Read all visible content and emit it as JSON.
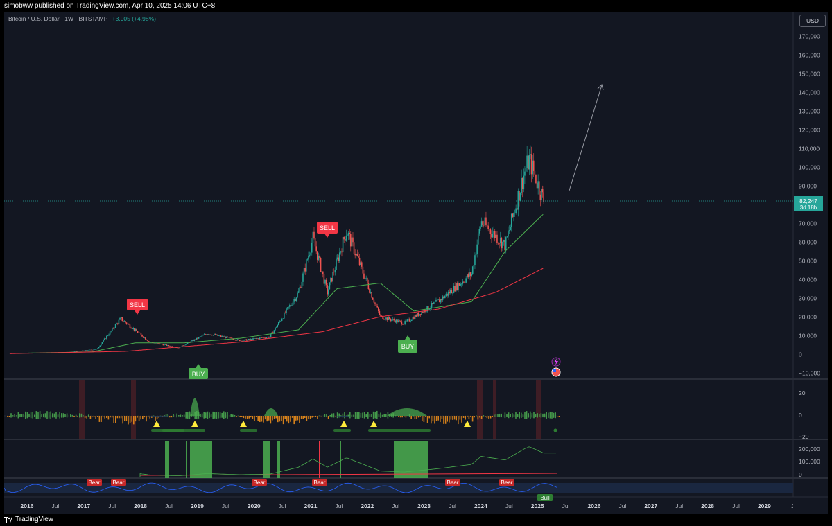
{
  "header": {
    "publisher_line": "simobww published on TradingView.com, Apr 10, 2025 14:06 UTC+8"
  },
  "legend": {
    "symbol_line": "Bitcoin / U.S. Dollar · 1W · BITSTAMP",
    "change": "+3,905 (+4.98%)"
  },
  "currency_button": "USD",
  "last_price": {
    "value": "82,247",
    "countdown": "3d 18h",
    "color": "#26a69a"
  },
  "price_axis": [
    "170,000",
    "160,000",
    "150,000",
    "140,000",
    "130,000",
    "120,000",
    "110,000",
    "100,000",
    "90,000",
    "80,000",
    "70,000",
    "60,000",
    "50,000",
    "40,000",
    "30,000",
    "20,000",
    "10,000",
    "0",
    "−10,000"
  ],
  "osc1_axis": [
    "20",
    "0",
    "−20"
  ],
  "osc2_axis": [
    "200,000",
    "100,000",
    "0"
  ],
  "time_axis": [
    "2016",
    "Jul",
    "2017",
    "Jul",
    "2018",
    "Jul",
    "2019",
    "Jul",
    "2020",
    "Jul",
    "2021",
    "Jul",
    "2022",
    "Jul",
    "2023",
    "Jul",
    "2024",
    "Jul",
    "2025",
    "Jul",
    "2026",
    "Jul",
    "2027",
    "Jul",
    "2028",
    "Jul",
    "2029",
    "J"
  ],
  "signals": [
    {
      "label": "SELL",
      "color": "#f23645"
    },
    {
      "label": "SELL",
      "color": "#f23645"
    },
    {
      "label": "BUY",
      "color": "#4caf50"
    },
    {
      "label": "BUY",
      "color": "#4caf50"
    }
  ],
  "rsi_tags": [
    "Bear",
    "Bear",
    "Bear",
    "Bear",
    "Bear",
    "Bear",
    "Bull"
  ],
  "colors": {
    "bull": "#26a69a",
    "bear": "#ef5350",
    "ma_green": "#4caf50",
    "ma_red": "#f23645",
    "accent": "#2962ff"
  },
  "footer": {
    "brand": "TradingView"
  },
  "chart_data": {
    "type": "line",
    "title": "Bitcoin / U.S. Dollar · 1W · BITSTAMP",
    "xlabel": "",
    "ylabel": "",
    "ylim": [
      -10000,
      175000
    ],
    "series": [
      {
        "name": "",
        "x": [
          "2016-01",
          "2016-07",
          "2017-01",
          "2017-07",
          "2017-12",
          "2018-06",
          "2018-12",
          "2019-06",
          "2020-01",
          "2020-07",
          "2021-01",
          "2021-04",
          "2021-07",
          "2021-11",
          "2022-06",
          "2022-11",
          "2023-06",
          "2024-01",
          "2024-03",
          "2024-08",
          "2024-12",
          "2025-01",
          "2025-04"
        ],
        "values": [
          430,
          650,
          1000,
          2600,
          19000,
          6500,
          3400,
          11000,
          7200,
          9200,
          33000,
          62000,
          33000,
          66000,
          20000,
          16500,
          28000,
          43000,
          71000,
          58000,
          97000,
          104000,
          82247
        ]
      },
      {
        "name": "",
        "x": [
          "2016-01",
          "2017-06",
          "2018-03",
          "2019-01",
          "2020-01",
          "2021-01",
          "2021-09",
          "2022-06",
          "2023-01",
          "2024-01",
          "2024-08",
          "2025-04"
        ],
        "values": [
          400,
          1200,
          6000,
          6000,
          8500,
          13000,
          35000,
          38000,
          23000,
          28000,
          55000,
          75000
        ]
      },
      {
        "name": "",
        "x": [
          "2016-01",
          "2018-01",
          "2020-01",
          "2021-06",
          "2022-06",
          "2023-06",
          "2024-06",
          "2025-04"
        ],
        "values": [
          300,
          1500,
          6500,
          12000,
          20000,
          24000,
          33000,
          46000
        ]
      }
    ]
  }
}
